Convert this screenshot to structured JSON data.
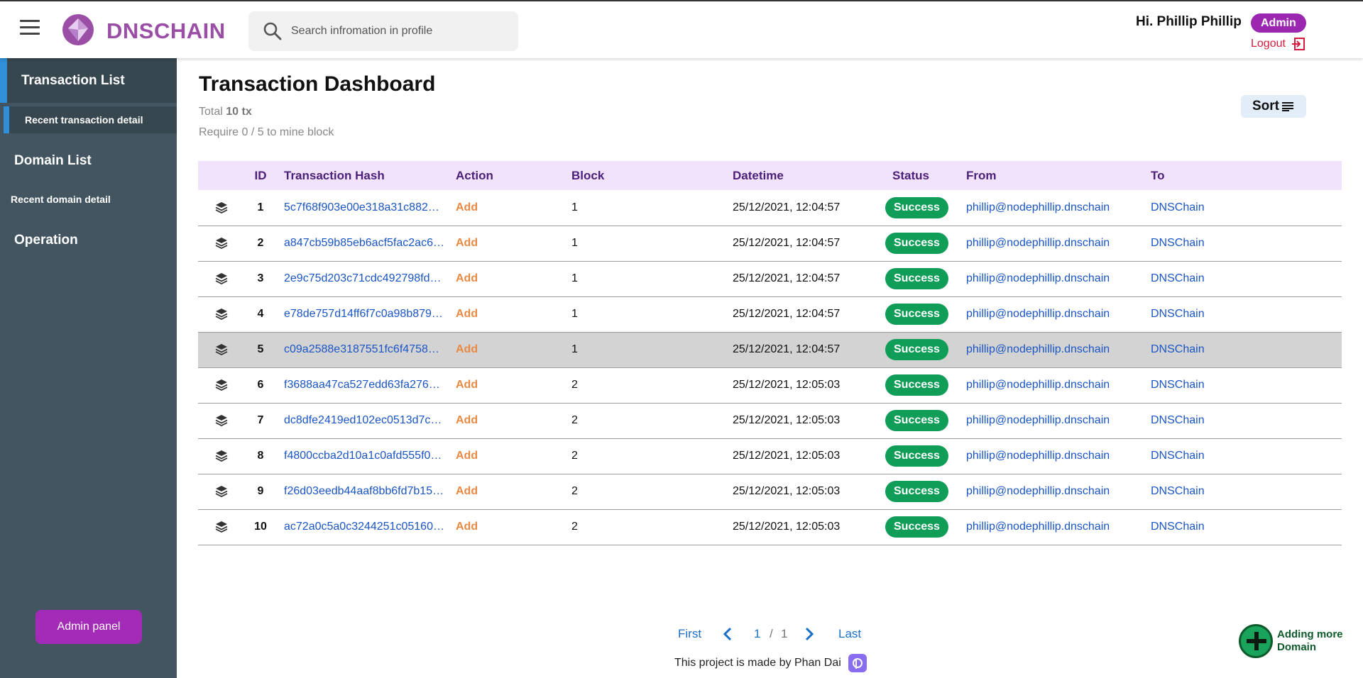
{
  "header": {
    "brand": "DNSCHAIN",
    "search_placeholder": "Search infromation in profile",
    "greeting": "Hi.  Phillip Phillip",
    "role_badge": "Admin",
    "logout_label": "Logout"
  },
  "sidebar": {
    "items": [
      {
        "label": "Transaction List"
      },
      {
        "label": "Recent transaction detail"
      },
      {
        "label": "Domain List"
      },
      {
        "label": "Recent domain detail"
      },
      {
        "label": "Operation"
      }
    ],
    "admin_panel_label": "Admin panel"
  },
  "main": {
    "title": "Transaction Dashboard",
    "total_prefix": "Total ",
    "total_value": "10 tx",
    "require_text": "Require 0 / 5 to mine block",
    "sort_label": "Sort"
  },
  "table": {
    "headers": {
      "id": "ID",
      "hash": "Transaction Hash",
      "action": "Action",
      "block": "Block",
      "datetime": "Datetime",
      "status": "Status",
      "from": "From",
      "to": "To"
    },
    "highlighted_row": 5,
    "rows": [
      {
        "id": "1",
        "hash": "5c7f68f903e00e318a31c882e…",
        "action": "Add",
        "block": "1",
        "datetime": "25/12/2021, 12:04:57",
        "status": "Success",
        "from": "phillip@nodephillip.dnschain",
        "to": "DNSChain"
      },
      {
        "id": "2",
        "hash": "a847cb59b85eb6acf5fac2ac6…",
        "action": "Add",
        "block": "1",
        "datetime": "25/12/2021, 12:04:57",
        "status": "Success",
        "from": "phillip@nodephillip.dnschain",
        "to": "DNSChain"
      },
      {
        "id": "3",
        "hash": "2e9c75d203c71cdc492798fd1…",
        "action": "Add",
        "block": "1",
        "datetime": "25/12/2021, 12:04:57",
        "status": "Success",
        "from": "phillip@nodephillip.dnschain",
        "to": "DNSChain"
      },
      {
        "id": "4",
        "hash": "e78de757d14ff6f7c0a98b879…",
        "action": "Add",
        "block": "1",
        "datetime": "25/12/2021, 12:04:57",
        "status": "Success",
        "from": "phillip@nodephillip.dnschain",
        "to": "DNSChain"
      },
      {
        "id": "5",
        "hash": "c09a2588e3187551fc6f4758c…",
        "action": "Add",
        "block": "1",
        "datetime": "25/12/2021, 12:04:57",
        "status": "Success",
        "from": "phillip@nodephillip.dnschain",
        "to": "DNSChain"
      },
      {
        "id": "6",
        "hash": "f3688aa47ca527edd63fa2769…",
        "action": "Add",
        "block": "2",
        "datetime": "25/12/2021, 12:05:03",
        "status": "Success",
        "from": "phillip@nodephillip.dnschain",
        "to": "DNSChain"
      },
      {
        "id": "7",
        "hash": "dc8dfe2419ed102ec0513d7c0…",
        "action": "Add",
        "block": "2",
        "datetime": "25/12/2021, 12:05:03",
        "status": "Success",
        "from": "phillip@nodephillip.dnschain",
        "to": "DNSChain"
      },
      {
        "id": "8",
        "hash": "f4800ccba2d10a1c0afd555f0…",
        "action": "Add",
        "block": "2",
        "datetime": "25/12/2021, 12:05:03",
        "status": "Success",
        "from": "phillip@nodephillip.dnschain",
        "to": "DNSChain"
      },
      {
        "id": "9",
        "hash": "f26d03eedb44aaf8bb6fd7b15…",
        "action": "Add",
        "block": "2",
        "datetime": "25/12/2021, 12:05:03",
        "status": "Success",
        "from": "phillip@nodephillip.dnschain",
        "to": "DNSChain"
      },
      {
        "id": "10",
        "hash": "ac72a0c5a0c3244251c05160…",
        "action": "Add",
        "block": "2",
        "datetime": "25/12/2021, 12:05:03",
        "status": "Success",
        "from": "phillip@nodephillip.dnschain",
        "to": "DNSChain"
      }
    ]
  },
  "pagination": {
    "first": "First",
    "current": "1",
    "separator": "/",
    "total": "1",
    "last": "Last"
  },
  "footer": {
    "note": "This project is made by Phan Dai"
  },
  "fab": {
    "line1": "Adding more",
    "line2": "Domain"
  },
  "icons": {
    "menu": "hamburger-icon",
    "logo": "diamond-logo-icon",
    "search": "search-icon",
    "logout": "logout-icon",
    "sort": "sort-lines-icon",
    "row": "layers-icon",
    "prev": "chevron-left-icon",
    "next": "chevron-right-icon",
    "add": "plus-icon"
  },
  "colors": {
    "brand": "#9a4ea6",
    "badge": "#9b27b0",
    "sidebar": "#435560",
    "accent_blue": "#2f8fd8",
    "success": "#0f9d58",
    "action": "#e98a44",
    "link": "#1a55c5",
    "table_header_bg": "#f1e3fb"
  }
}
